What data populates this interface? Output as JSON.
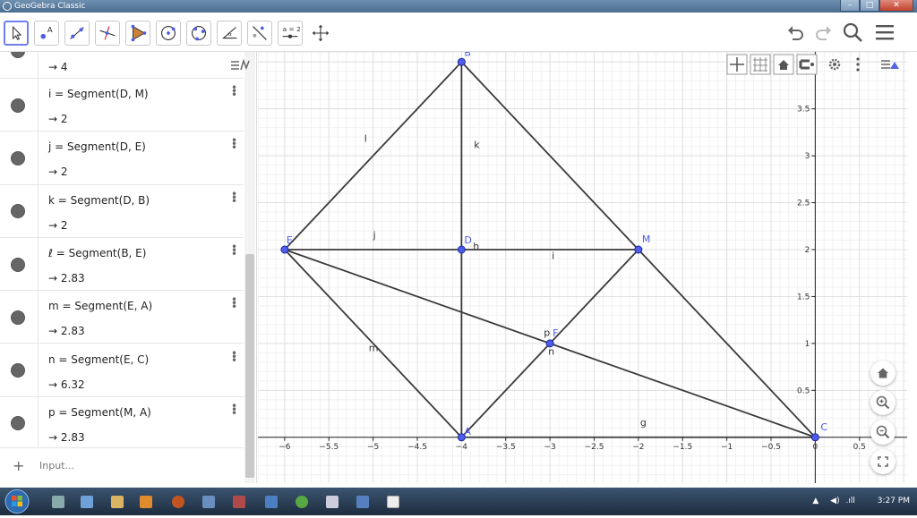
{
  "window": {
    "title": "GeoGebra Classic"
  },
  "algebra": {
    "top_value": "→ 4",
    "rows": [
      {
        "def": "i = Segment(D, M)",
        "val": "→ 2"
      },
      {
        "def": "j = Segment(D, E)",
        "val": "→ 2"
      },
      {
        "def": "k = Segment(D, B)",
        "val": "→ 2"
      },
      {
        "def": "ℓ = Segment(B, E)",
        "val": "→ 2.83"
      },
      {
        "def": "m = Segment(E, A)",
        "val": "→ 2.83"
      },
      {
        "def": "n = Segment(E, C)",
        "val": "→ 6.32"
      },
      {
        "def": "p = Segment(M, A)",
        "val": "→ 2.83"
      }
    ],
    "input_placeholder": "Input..."
  },
  "toolbar": {
    "tools": [
      "move-tool",
      "point-tool",
      "line-tool",
      "perpendicular-tool",
      "polygon-tool",
      "circle-tool",
      "circle-three-points-tool",
      "angle-tool",
      "reflect-tool",
      "slider-tool",
      "move-graphics-tool"
    ],
    "slider_label": "a = 2"
  },
  "graph": {
    "xrange": [
      -6.1,
      1.1
    ],
    "yrange": [
      -0.05,
      4.05
    ],
    "x_ticks": [
      -6,
      -5.5,
      -5,
      -4.5,
      -4,
      -3.5,
      -3,
      -2.5,
      -2,
      -1.5,
      -1,
      -0.5,
      0,
      0.5
    ],
    "x_tick_labels": [
      "−6",
      "−5.5",
      "−5",
      "−4.5",
      "−4",
      "−3.5",
      "−3",
      "−2.5",
      "−2",
      "−1.5",
      "−1",
      "−0.5",
      "0",
      "0.5"
    ],
    "y_ticks": [
      0.5,
      1,
      1.5,
      2,
      2.5,
      3,
      3.5
    ],
    "y_tick_labels": [
      "0.5",
      "1",
      "1.5",
      "2",
      "2.5",
      "3",
      "3.5"
    ],
    "points": [
      {
        "name": "A",
        "x": -4,
        "y": 0
      },
      {
        "name": "B",
        "x": -4,
        "y": 4
      },
      {
        "name": "C",
        "x": 0,
        "y": 0
      },
      {
        "name": "D",
        "x": -4,
        "y": 2
      },
      {
        "name": "E",
        "x": -6,
        "y": 2
      },
      {
        "name": "M",
        "x": -2,
        "y": 2
      },
      {
        "name": "F",
        "x": -3,
        "y": 1
      }
    ],
    "segments": [
      {
        "name": "g",
        "from": "A",
        "to": "C"
      },
      {
        "name": "h",
        "from": "A",
        "to": "D"
      },
      {
        "name": "k",
        "from": "D",
        "to": "B"
      },
      {
        "name": "l",
        "from": "B",
        "to": "E"
      },
      {
        "name": "",
        "from": "B",
        "to": "C"
      },
      {
        "name": "j",
        "from": "E",
        "to": "D"
      },
      {
        "name": "i",
        "from": "D",
        "to": "M"
      },
      {
        "name": "m",
        "from": "E",
        "to": "A"
      },
      {
        "name": "n",
        "from": "E",
        "to": "C"
      },
      {
        "name": "p",
        "from": "M",
        "to": "A"
      }
    ],
    "segment_labels": [
      {
        "text": "l",
        "x": -5.1,
        "y": 3.15
      },
      {
        "text": "k",
        "x": -3.86,
        "y": 3.08
      },
      {
        "text": "j",
        "x": -5.0,
        "y": 2.12
      },
      {
        "text": "h",
        "x": -3.87,
        "y": 2.0
      },
      {
        "text": "i",
        "x": -2.98,
        "y": 1.9
      },
      {
        "text": "m",
        "x": -5.05,
        "y": 0.92
      },
      {
        "text": "p",
        "x": -3.07,
        "y": 1.08
      },
      {
        "text": "n",
        "x": -3.02,
        "y": 0.88
      },
      {
        "text": "g",
        "x": -1.98,
        "y": 0.12
      }
    ],
    "colors": {
      "point": "#4d5de8",
      "point_stroke": "#1c27a6",
      "segment": "#3a3a3a",
      "label_point": "#4d5de8",
      "grid_major": "#e0e0e0",
      "grid_minor": "#f1f1f1",
      "axis": "#222"
    }
  },
  "taskbar": {
    "time": "3:27 PM"
  }
}
